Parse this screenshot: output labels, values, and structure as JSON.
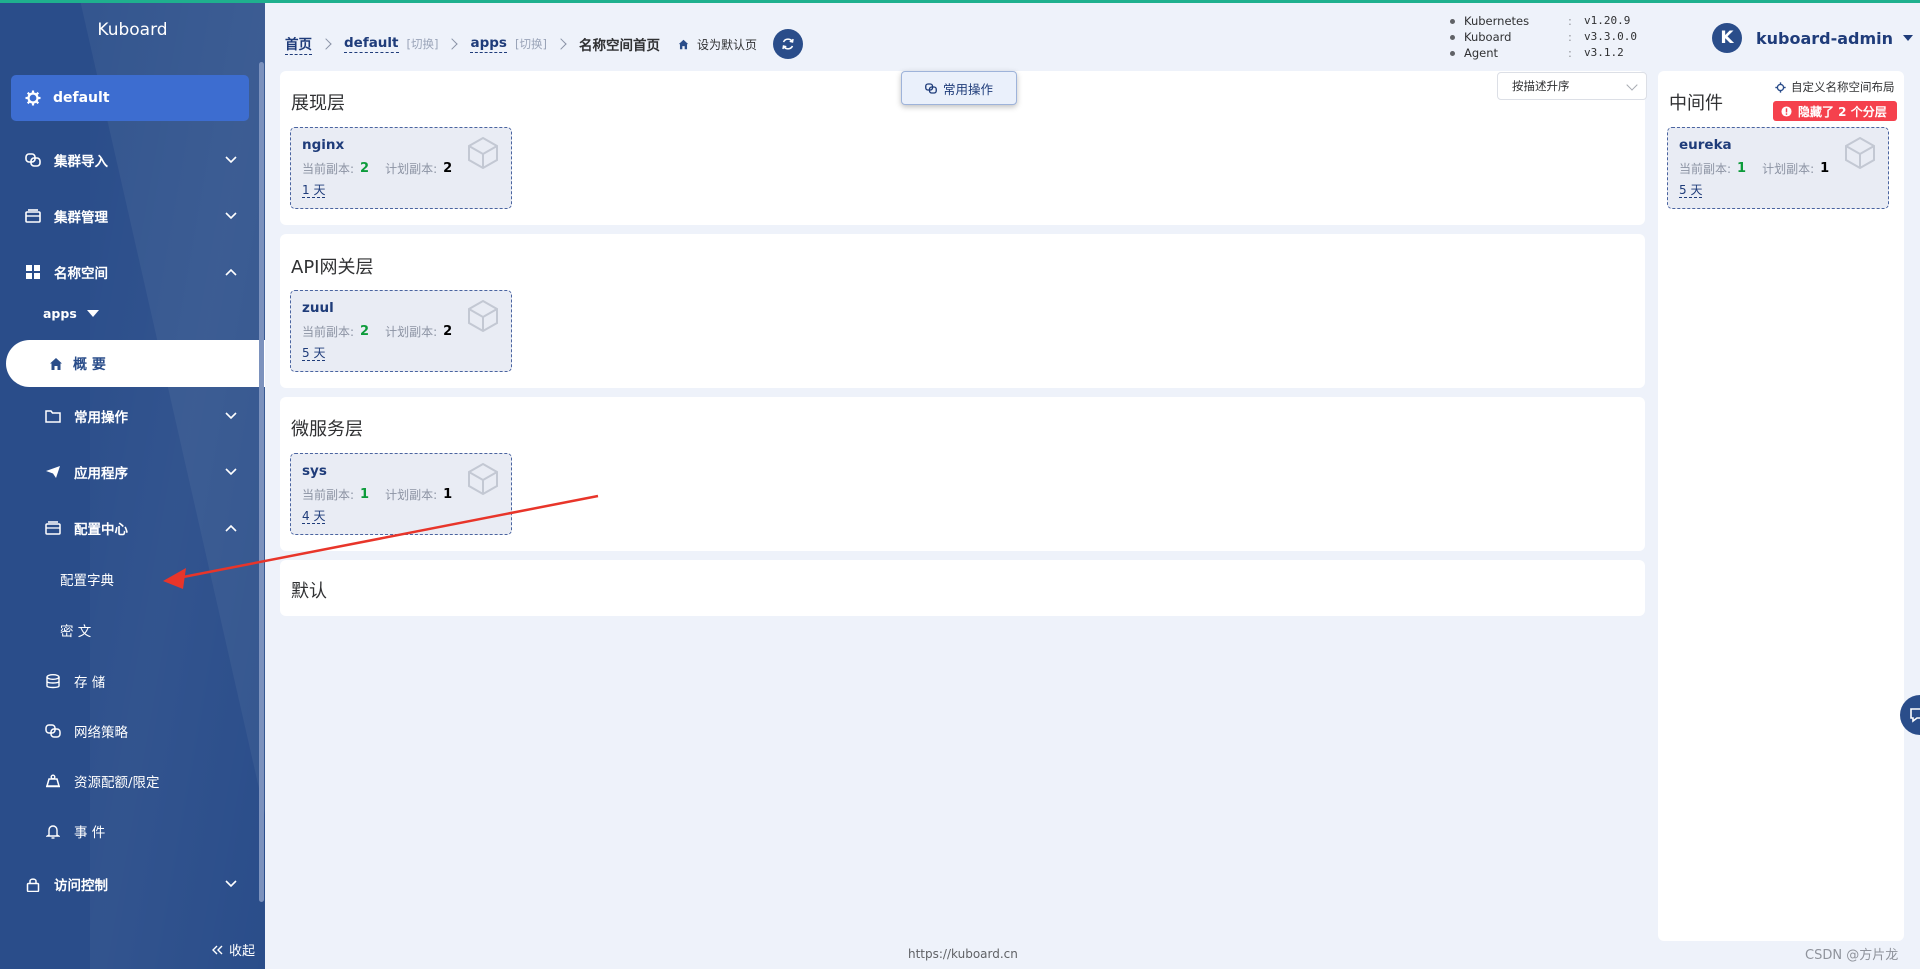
{
  "app": {
    "title": "Kuboard"
  },
  "sidebar": {
    "cluster": "default",
    "items": {
      "cluster_import": "集群导入",
      "cluster_manage": "集群管理",
      "namespace": "名称空间",
      "namespace_selected": "apps",
      "overview": "概 要",
      "common_ops": "常用操作",
      "apps": "应用程序",
      "config_center": "配置中心",
      "config_dict": "配置字典",
      "secret": "密 文",
      "storage": "存 储",
      "network_policy": "网络策略",
      "resource_quota": "资源配额/限定",
      "events": "事 件",
      "access_control": "访问控制"
    },
    "collapse": "收起"
  },
  "header": {
    "breadcrumb": {
      "home": "首页",
      "cluster": "default",
      "switch1": "[切换]",
      "namespace": "apps",
      "switch2": "[切换]",
      "current": "名称空间首页"
    },
    "set_default": "设为默认页",
    "versions": [
      {
        "name": "Kubernetes",
        "sep": ":",
        "version": "v1.20.9"
      },
      {
        "name": "Kuboard",
        "sep": ":",
        "version": "v3.3.0.0"
      },
      {
        "name": "Agent",
        "sep": ":",
        "version": "v3.1.2"
      }
    ],
    "user": {
      "avatar_letter": "K",
      "name": "kuboard-admin"
    }
  },
  "common_ops_button": "常用操作",
  "sort_select": {
    "value": "按描述升序"
  },
  "layers": [
    {
      "title": "展现层",
      "workloads": [
        {
          "name": "nginx",
          "current_label": "当前副本:",
          "current": "2",
          "planned_label": "计划副本:",
          "planned": "2",
          "age": "1 天"
        }
      ]
    },
    {
      "title": "API网关层",
      "workloads": [
        {
          "name": "zuul",
          "current_label": "当前副本:",
          "current": "2",
          "planned_label": "计划副本:",
          "planned": "2",
          "age": "5 天"
        }
      ]
    },
    {
      "title": "微服务层",
      "workloads": [
        {
          "name": "sys",
          "current_label": "当前副本:",
          "current": "1",
          "planned_label": "计划副本:",
          "planned": "1",
          "age": "4 天"
        }
      ]
    },
    {
      "title": "默认",
      "workloads": []
    }
  ],
  "middleware": {
    "title": "中间件",
    "custom_layout": "自定义名称空间布局",
    "hidden_badge": "隐藏了 2 个分层",
    "workloads": [
      {
        "name": "eureka",
        "current_label": "当前副本:",
        "current": "1",
        "planned_label": "计划副本:",
        "planned": "1",
        "age": "5 天"
      }
    ]
  },
  "footer": {
    "url": "https://kuboard.cn",
    "watermark": "CSDN @方片龙"
  },
  "colors": {
    "sidebar": "#2a4d8a",
    "accent": "#3d6dd0",
    "running": "#0c9b3a",
    "badge": "#f5414d",
    "annotation_arrow": "#e8352a"
  }
}
